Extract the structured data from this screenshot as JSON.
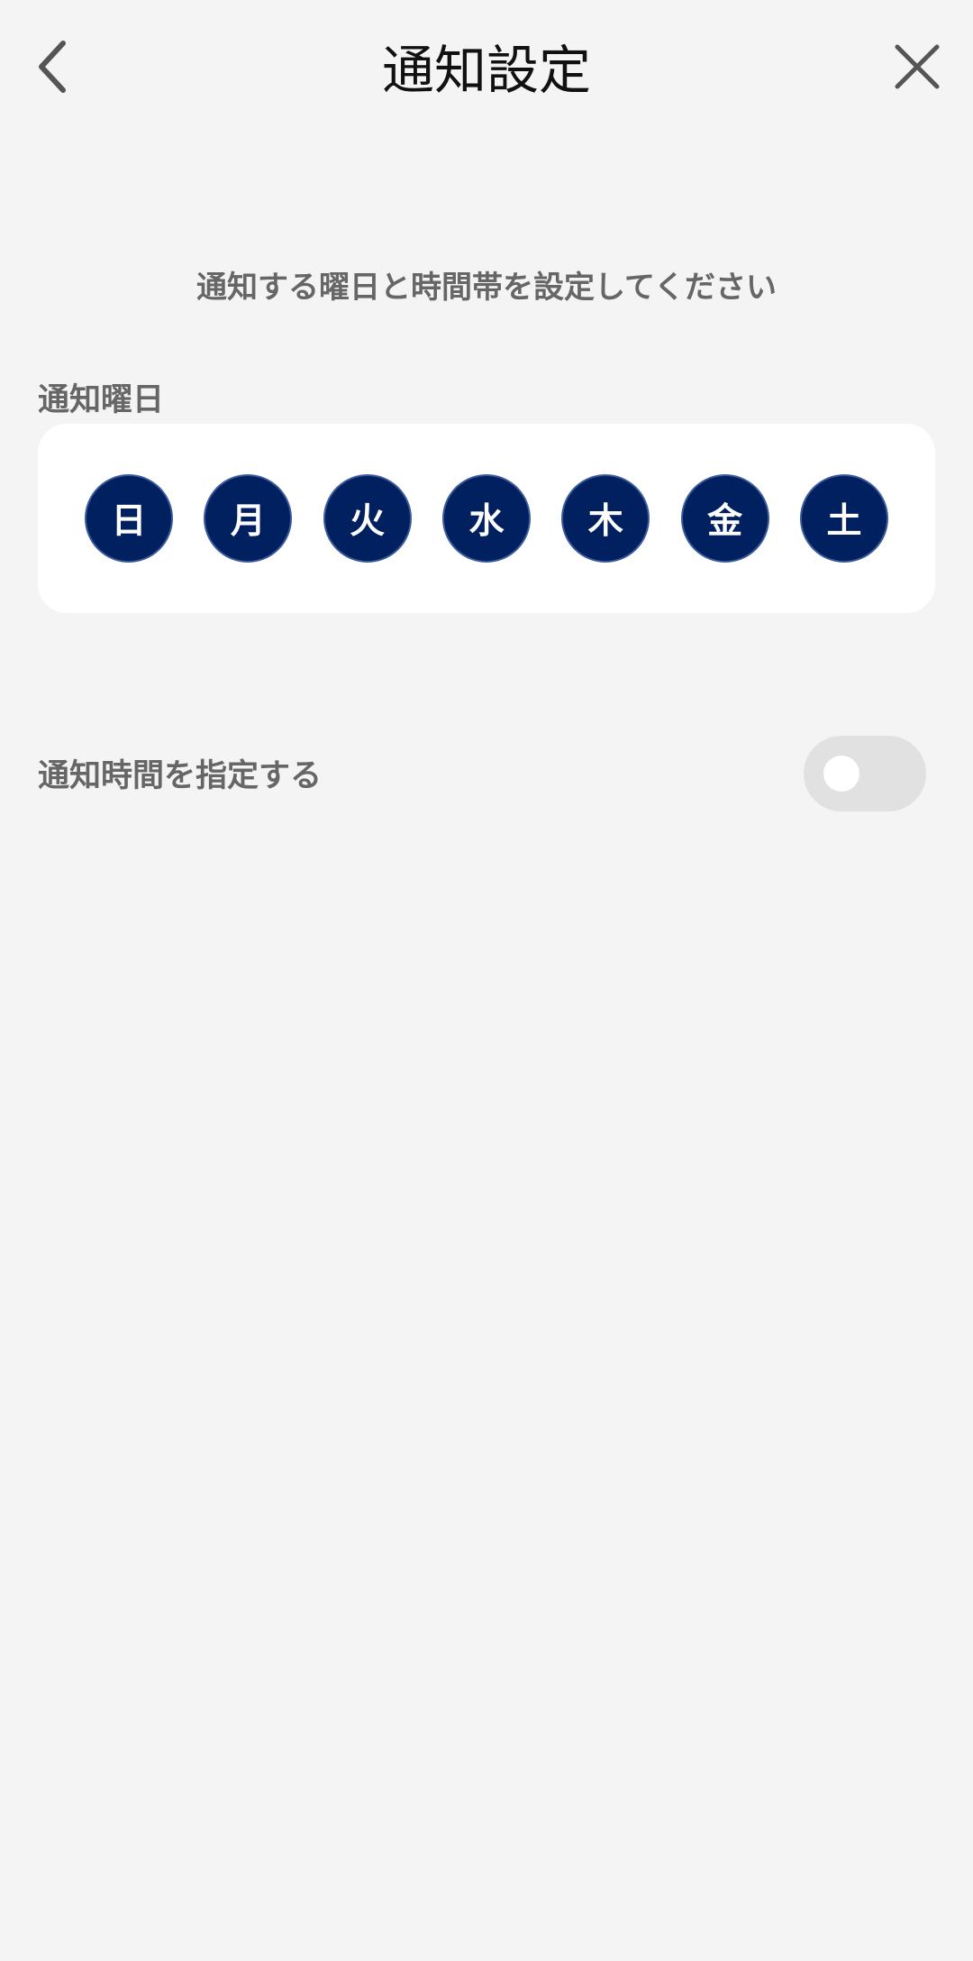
{
  "header": {
    "title": "通知設定",
    "back_icon": "chevron-left-icon",
    "close_icon": "close-icon"
  },
  "instruction": "通知する曜日と時間帯を設定してください",
  "days_section": {
    "label": "通知曜日",
    "days": [
      {
        "label": "日"
      },
      {
        "label": "月"
      },
      {
        "label": "火"
      },
      {
        "label": "水"
      },
      {
        "label": "木"
      },
      {
        "label": "金"
      },
      {
        "label": "土"
      }
    ]
  },
  "time_setting": {
    "label": "通知時間を指定する",
    "enabled": false
  },
  "colors": {
    "accent": "#002060",
    "background": "#f4f4f4",
    "toggle_off": "#e1e1e1"
  }
}
